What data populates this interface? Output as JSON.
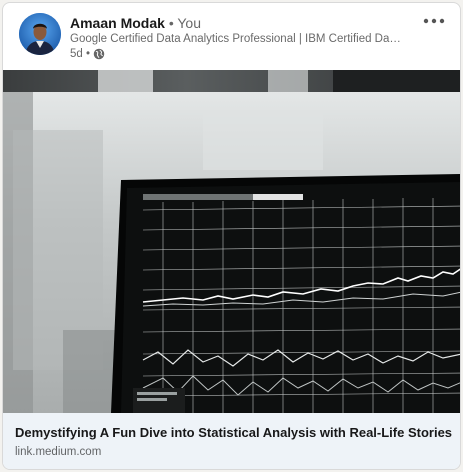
{
  "post": {
    "author_name": "Amaan Modak",
    "relationship": "• You",
    "headline": "Google Certified Data Analytics Professional | IBM Certified Data W...",
    "time_ago": "5d •",
    "visibility_icon": "globe-icon",
    "menu_icon": "more-horizontal-icon"
  },
  "link_preview": {
    "title": "Demystifying A Fun Dive into Statistical Analysis with Real-Life Stories",
    "domain": "link.medium.com",
    "image_description_icon": "laptop-chart-image"
  },
  "colors": {
    "card_bg": "#ffffff",
    "footer_bg": "#eef3f8",
    "avatar_bg": "#2f7fd8"
  }
}
